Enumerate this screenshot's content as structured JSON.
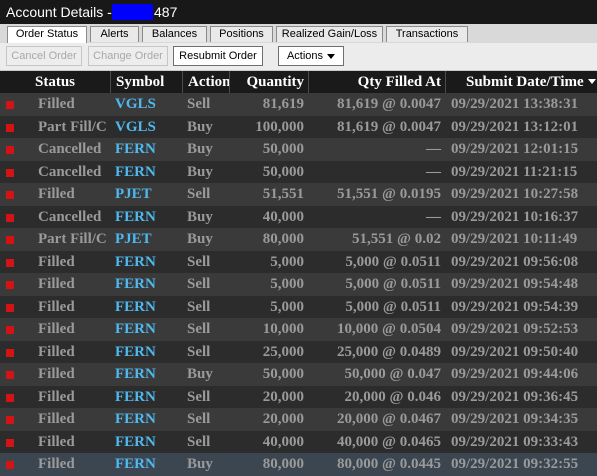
{
  "titlebar": {
    "title": "Account Details -",
    "account_suffix": "487"
  },
  "tabs": [
    {
      "label": "Order Status"
    },
    {
      "label": "Alerts"
    },
    {
      "label": "Balances"
    },
    {
      "label": "Positions"
    },
    {
      "label": "Realized Gain/Loss"
    },
    {
      "label": "Transactions"
    }
  ],
  "toolbar": {
    "cancel_label": "Cancel Order",
    "change_label": "Change Order",
    "resubmit_label": "Resubmit Order",
    "actions_label": "Actions"
  },
  "table": {
    "columns": {
      "status": "Status",
      "symbol": "Symbol",
      "action": "Action",
      "quantity": "Quantity",
      "qty_filled": "Qty Filled At",
      "submit": "Submit Date/Time"
    },
    "rows": [
      {
        "status": "Filled",
        "symbol": "VGLS",
        "action": "Sell",
        "quantity": "81,619",
        "filled": "81,619 @ 0.0047",
        "submit": "09/29/2021 13:38:31"
      },
      {
        "status": "Part Fill/C",
        "symbol": "VGLS",
        "action": "Buy",
        "quantity": "100,000",
        "filled": "81,619 @ 0.0047",
        "submit": "09/29/2021 13:12:01"
      },
      {
        "status": "Cancelled",
        "symbol": "FERN",
        "action": "Buy",
        "quantity": "50,000",
        "filled": "—",
        "submit": "09/29/2021 12:01:15"
      },
      {
        "status": "Cancelled",
        "symbol": "FERN",
        "action": "Buy",
        "quantity": "50,000",
        "filled": "—",
        "submit": "09/29/2021 11:21:15"
      },
      {
        "status": "Filled",
        "symbol": "PJET",
        "action": "Sell",
        "quantity": "51,551",
        "filled": "51,551 @ 0.0195",
        "submit": "09/29/2021 10:27:58"
      },
      {
        "status": "Cancelled",
        "symbol": "FERN",
        "action": "Buy",
        "quantity": "40,000",
        "filled": "—",
        "submit": "09/29/2021 10:16:37"
      },
      {
        "status": "Part Fill/C",
        "symbol": "PJET",
        "action": "Buy",
        "quantity": "80,000",
        "filled": "51,551 @ 0.02",
        "submit": "09/29/2021 10:11:49"
      },
      {
        "status": "Filled",
        "symbol": "FERN",
        "action": "Sell",
        "quantity": "5,000",
        "filled": "5,000 @ 0.0511",
        "submit": "09/29/2021 09:56:08"
      },
      {
        "status": "Filled",
        "symbol": "FERN",
        "action": "Sell",
        "quantity": "5,000",
        "filled": "5,000 @ 0.0511",
        "submit": "09/29/2021 09:54:48"
      },
      {
        "status": "Filled",
        "symbol": "FERN",
        "action": "Sell",
        "quantity": "5,000",
        "filled": "5,000 @ 0.0511",
        "submit": "09/29/2021 09:54:39"
      },
      {
        "status": "Filled",
        "symbol": "FERN",
        "action": "Sell",
        "quantity": "10,000",
        "filled": "10,000 @ 0.0504",
        "submit": "09/29/2021 09:52:53"
      },
      {
        "status": "Filled",
        "symbol": "FERN",
        "action": "Sell",
        "quantity": "25,000",
        "filled": "25,000 @ 0.0489",
        "submit": "09/29/2021 09:50:40"
      },
      {
        "status": "Filled",
        "symbol": "FERN",
        "action": "Buy",
        "quantity": "50,000",
        "filled": "50,000 @ 0.047",
        "submit": "09/29/2021 09:44:06"
      },
      {
        "status": "Filled",
        "symbol": "FERN",
        "action": "Sell",
        "quantity": "20,000",
        "filled": "20,000 @ 0.046",
        "submit": "09/29/2021 09:36:45"
      },
      {
        "status": "Filled",
        "symbol": "FERN",
        "action": "Sell",
        "quantity": "20,000",
        "filled": "20,000 @ 0.0467",
        "submit": "09/29/2021 09:34:35"
      },
      {
        "status": "Filled",
        "symbol": "FERN",
        "action": "Sell",
        "quantity": "40,000",
        "filled": "40,000 @ 0.0465",
        "submit": "09/29/2021 09:33:43"
      },
      {
        "status": "Filled",
        "symbol": "FERN",
        "action": "Buy",
        "quantity": "80,000",
        "filled": "80,000 @ 0.0445",
        "submit": "09/29/2021 09:32:55"
      }
    ]
  },
  "colors": {
    "symbol": "#4fb8ee",
    "indicator": "#d41414",
    "text_muted": "#9a9a9a"
  }
}
